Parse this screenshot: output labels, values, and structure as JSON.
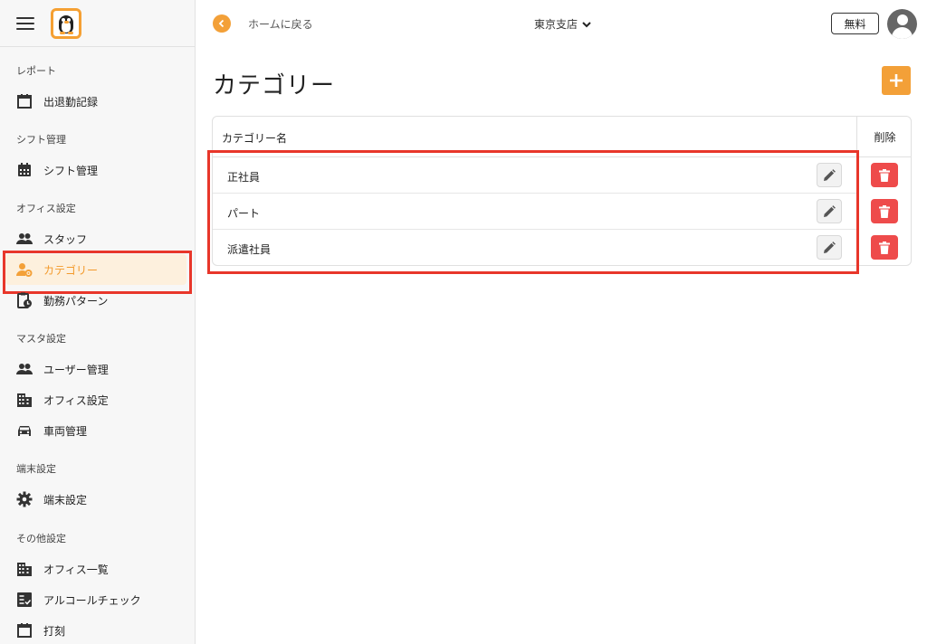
{
  "sidebar": {
    "sections": [
      {
        "title": "レポート",
        "items": [
          {
            "label": "出退勤記録",
            "icon": "calendar-icon"
          }
        ]
      },
      {
        "title": "シフト管理",
        "items": [
          {
            "label": "シフト管理",
            "icon": "calendar-grid-icon"
          }
        ]
      },
      {
        "title": "オフィス設定",
        "items": [
          {
            "label": "スタッフ",
            "icon": "people-icon"
          },
          {
            "label": "カテゴリー",
            "icon": "person-gear-icon"
          },
          {
            "label": "勤務パターン",
            "icon": "clipboard-clock-icon"
          }
        ]
      },
      {
        "title": "マスタ設定",
        "items": [
          {
            "label": "ユーザー管理",
            "icon": "people-icon"
          },
          {
            "label": "オフィス設定",
            "icon": "building-icon"
          },
          {
            "label": "車両管理",
            "icon": "car-icon"
          }
        ]
      },
      {
        "title": "端末設定",
        "items": [
          {
            "label": "端末設定",
            "icon": "gear-icon"
          }
        ]
      },
      {
        "title": "その他設定",
        "items": [
          {
            "label": "オフィス一覧",
            "icon": "building-icon"
          },
          {
            "label": "アルコールチェック",
            "icon": "checklist-icon"
          },
          {
            "label": "打刻",
            "icon": "calendar-icon"
          }
        ]
      }
    ]
  },
  "header": {
    "back_label": "ホームに戻る",
    "branch": "東京支店",
    "plan": "無料"
  },
  "main": {
    "title": "カテゴリー",
    "table": {
      "col_name": "カテゴリー名",
      "col_delete": "削除",
      "rows": [
        {
          "name": "正社員"
        },
        {
          "name": "パート"
        },
        {
          "name": "派遣社員"
        }
      ]
    }
  },
  "colors": {
    "accent": "#f3a038",
    "danger": "#ee4b4b",
    "highlight": "#e8362a"
  }
}
